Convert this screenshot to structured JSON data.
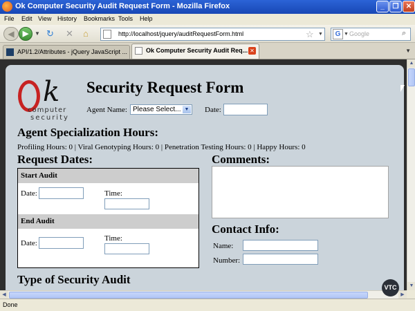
{
  "window": {
    "title": "Ok Computer Security Audit Request Form - Mozilla Firefox"
  },
  "menu": [
    "File",
    "Edit",
    "View",
    "History",
    "Bookmarks",
    "Tools",
    "Help"
  ],
  "address": {
    "url": "http://localhost/jquery/auditRequestForm.html"
  },
  "search": {
    "engine": "G",
    "placeholder": "Google"
  },
  "tabs": [
    {
      "label": "API/1.2/Attributes - jQuery JavaScript ...",
      "active": false
    },
    {
      "label": "Ok Computer Security Audit Req...",
      "active": true
    }
  ],
  "logo": {
    "mark": "k",
    "line1": "computer",
    "line2": "security"
  },
  "form": {
    "title": "Security Request Form",
    "agent_name_label": "Agent Name:",
    "agent_select_value": "Please Select...",
    "date_label": "Date:",
    "specialization_title": "Agent Specialization Hours:",
    "hours_text": "Profiling Hours: 0 | Viral Genotyping Hours: 0 | Penetration Testing Hours: 0 | Happy Hours: 0",
    "request_dates_title": "Request Dates:",
    "start_audit": {
      "heading": "Start Audit",
      "date_label": "Date:",
      "time_label": "Time:"
    },
    "end_audit": {
      "heading": "End Audit",
      "date_label": "Date:",
      "time_label": "Time:"
    },
    "comments_title": "Comments:",
    "contact_title": "Contact Info:",
    "name_label": "Name:",
    "number_label": "Number:",
    "type_title": "Type of Security Audit"
  },
  "status": {
    "text": "Done"
  },
  "watermark": "VTC",
  "colors": {
    "page_bg": "#cbd4db",
    "titlebar": "#1f52c4",
    "logo_red": "#c72222"
  }
}
